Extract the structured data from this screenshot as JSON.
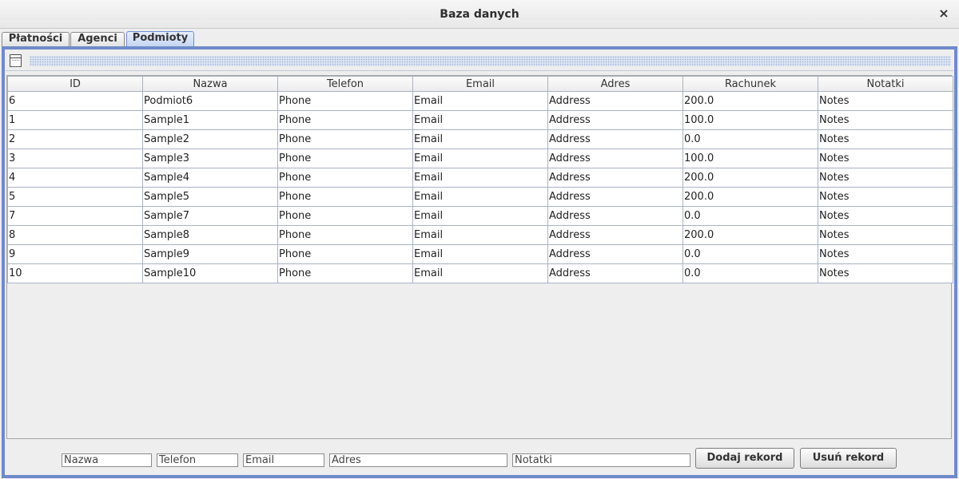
{
  "window": {
    "title": "Baza danych",
    "close_symbol": "×"
  },
  "tabs": [
    {
      "label": "Płatności"
    },
    {
      "label": "Agenci"
    },
    {
      "label": "Podmioty",
      "active": true
    }
  ],
  "table": {
    "columns": [
      "ID",
      "Nazwa",
      "Telefon",
      "Email",
      "Adres",
      "Rachunek",
      "Notatki"
    ],
    "rows": [
      [
        "6",
        "Podmiot6",
        "Phone",
        "Email",
        "Address",
        "200.0",
        "Notes"
      ],
      [
        "1",
        "Sample1",
        "Phone",
        "Email",
        "Address",
        "100.0",
        "Notes"
      ],
      [
        "2",
        "Sample2",
        "Phone",
        "Email",
        "Address",
        "0.0",
        "Notes"
      ],
      [
        "3",
        "Sample3",
        "Phone",
        "Email",
        "Address",
        "100.0",
        "Notes"
      ],
      [
        "4",
        "Sample4",
        "Phone",
        "Email",
        "Address",
        "200.0",
        "Notes"
      ],
      [
        "5",
        "Sample5",
        "Phone",
        "Email",
        "Address",
        "200.0",
        "Notes"
      ],
      [
        "7",
        "Sample7",
        "Phone",
        "Email",
        "Address",
        "0.0",
        "Notes"
      ],
      [
        "8",
        "Sample8",
        "Phone",
        "Email",
        "Address",
        "200.0",
        "Notes"
      ],
      [
        "9",
        "Sample9",
        "Phone",
        "Email",
        "Address",
        "0.0",
        "Notes"
      ],
      [
        "10",
        "Sample10",
        "Phone",
        "Email",
        "Address",
        "0.0",
        "Notes"
      ]
    ]
  },
  "form": {
    "fields": [
      {
        "value": "Nazwa"
      },
      {
        "value": "Telefon"
      },
      {
        "value": "Email"
      },
      {
        "value": "Adres"
      },
      {
        "value": "Notatki"
      }
    ],
    "add_button": "Dodaj rekord",
    "delete_button": "Usuń rekord"
  },
  "icons": {
    "toolbar": "window-icon",
    "close": "close-icon"
  },
  "colors": {
    "panel_border": "#6e8bc9",
    "active_tab": "#c6d6f2",
    "grid_lines": "#a9b2c3"
  }
}
